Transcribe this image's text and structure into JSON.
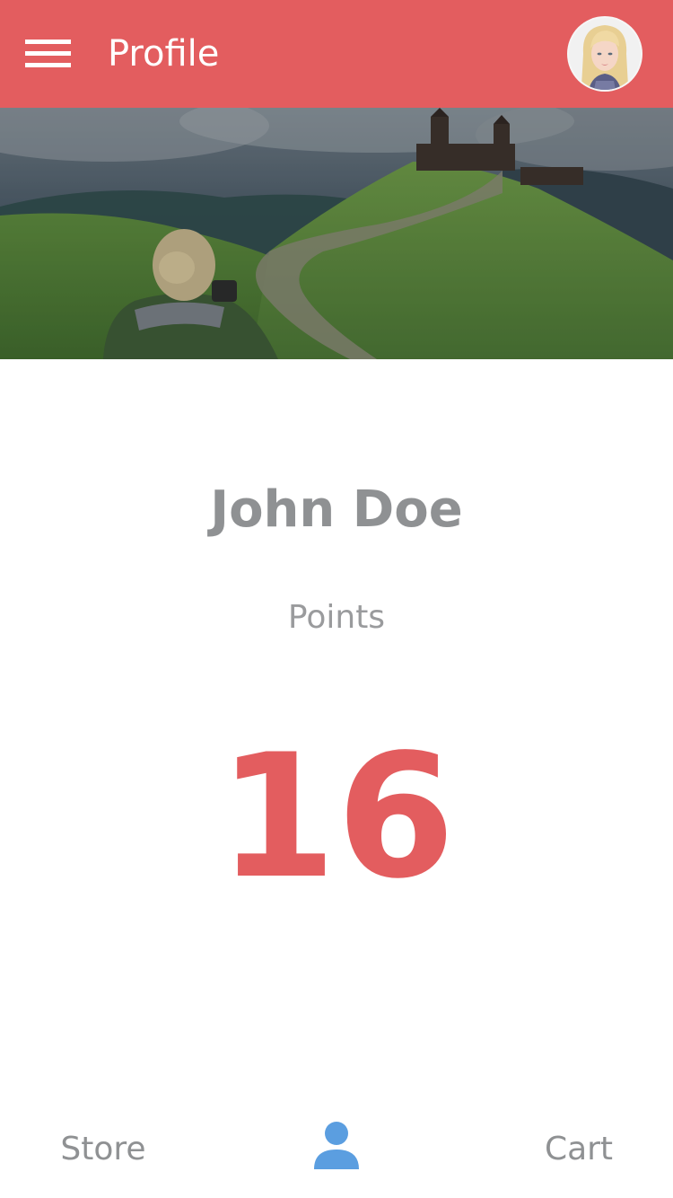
{
  "header": {
    "title": "Profile",
    "menu_icon": "hamburger-menu-icon",
    "avatar_icon": "user-avatar"
  },
  "cover": {
    "image": "cover-photo-hiker-landscape"
  },
  "profile": {
    "name": "John Doe",
    "points_label": "Points",
    "points_value": "16"
  },
  "bottom_nav": {
    "store_label": "Store",
    "profile_icon": "person-icon",
    "cart_label": "Cart"
  },
  "colors": {
    "accent": "#e35d5f",
    "text_muted": "#8f9193",
    "nav_active": "#5b9ee0"
  }
}
